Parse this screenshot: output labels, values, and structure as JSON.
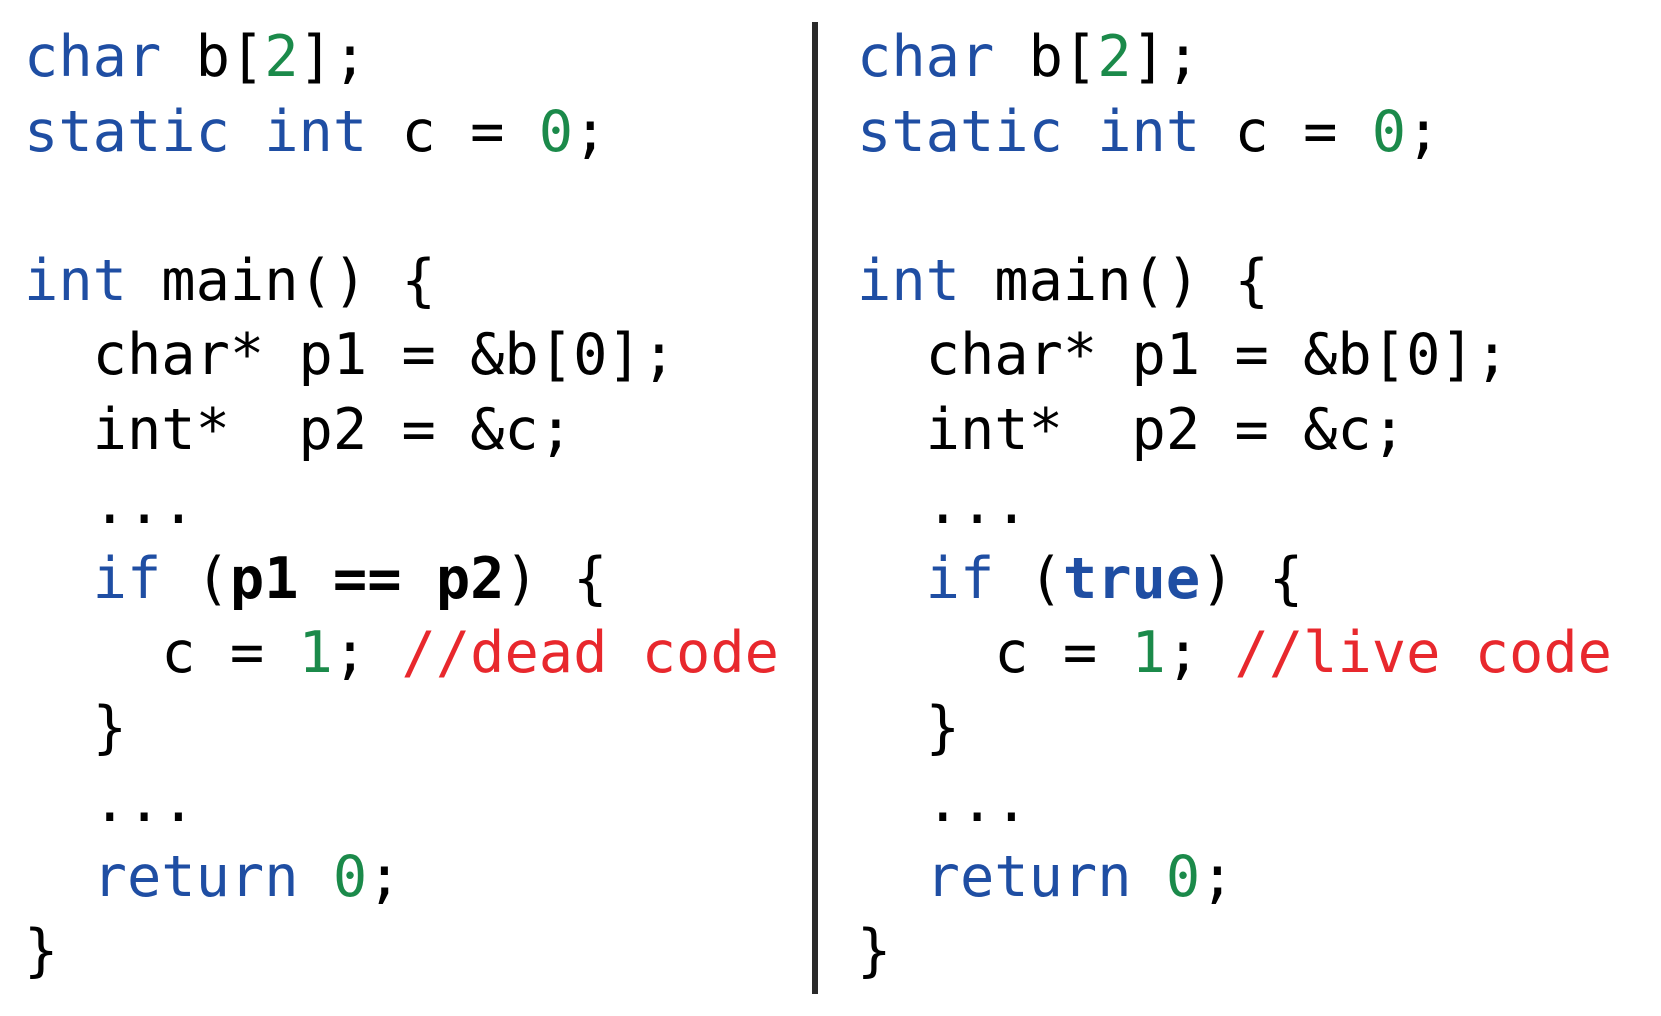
{
  "colors": {
    "keyword": "#1f4ea3",
    "number": "#1b8a4a",
    "comment": "#e8282d",
    "text": "#000000",
    "divider": "#2a2a2a"
  },
  "panels": [
    {
      "name": "left",
      "lines": [
        [
          {
            "t": "char",
            "c": "kw"
          },
          {
            "t": " b[",
            "c": "txt"
          },
          {
            "t": "2",
            "c": "num"
          },
          {
            "t": "];",
            "c": "txt"
          }
        ],
        [
          {
            "t": "static",
            "c": "kw"
          },
          {
            "t": " ",
            "c": "txt"
          },
          {
            "t": "int",
            "c": "kw"
          },
          {
            "t": " c = ",
            "c": "txt"
          },
          {
            "t": "0",
            "c": "num"
          },
          {
            "t": ";",
            "c": "txt"
          }
        ],
        [],
        [
          {
            "t": "int",
            "c": "kw"
          },
          {
            "t": " main() {",
            "c": "txt"
          }
        ],
        [
          {
            "t": "  char* p1 = &b[0];",
            "c": "txt"
          }
        ],
        [
          {
            "t": "  int*  p2 = &c;",
            "c": "txt"
          }
        ],
        [
          {
            "t": "  ...",
            "c": "txt"
          }
        ],
        [
          {
            "t": "  ",
            "c": "txt"
          },
          {
            "t": "if",
            "c": "kw"
          },
          {
            "t": " (",
            "c": "txt"
          },
          {
            "t": "p1 == p2",
            "c": "txt",
            "b": true
          },
          {
            "t": ") {",
            "c": "txt"
          }
        ],
        [
          {
            "t": "    c = ",
            "c": "txt"
          },
          {
            "t": "1",
            "c": "num"
          },
          {
            "t": "; ",
            "c": "txt"
          },
          {
            "t": "//dead code",
            "c": "cmt"
          }
        ],
        [
          {
            "t": "  }",
            "c": "txt"
          }
        ],
        [
          {
            "t": "  ...",
            "c": "txt"
          }
        ],
        [
          {
            "t": "  ",
            "c": "txt"
          },
          {
            "t": "return",
            "c": "kw"
          },
          {
            "t": " ",
            "c": "txt"
          },
          {
            "t": "0",
            "c": "num"
          },
          {
            "t": ";",
            "c": "txt"
          }
        ],
        [
          {
            "t": "}",
            "c": "txt"
          }
        ]
      ]
    },
    {
      "name": "right",
      "lines": [
        [
          {
            "t": "char",
            "c": "kw"
          },
          {
            "t": " b[",
            "c": "txt"
          },
          {
            "t": "2",
            "c": "num"
          },
          {
            "t": "];",
            "c": "txt"
          }
        ],
        [
          {
            "t": "static",
            "c": "kw"
          },
          {
            "t": " ",
            "c": "txt"
          },
          {
            "t": "int",
            "c": "kw"
          },
          {
            "t": " c = ",
            "c": "txt"
          },
          {
            "t": "0",
            "c": "num"
          },
          {
            "t": ";",
            "c": "txt"
          }
        ],
        [],
        [
          {
            "t": "int",
            "c": "kw"
          },
          {
            "t": " main() {",
            "c": "txt"
          }
        ],
        [
          {
            "t": "  char* p1 = &b[0];",
            "c": "txt"
          }
        ],
        [
          {
            "t": "  int*  p2 = &c;",
            "c": "txt"
          }
        ],
        [
          {
            "t": "  ...",
            "c": "txt"
          }
        ],
        [
          {
            "t": "  ",
            "c": "txt"
          },
          {
            "t": "if",
            "c": "kw"
          },
          {
            "t": " (",
            "c": "txt"
          },
          {
            "t": "true",
            "c": "kw",
            "b": true
          },
          {
            "t": ") {",
            "c": "txt"
          }
        ],
        [
          {
            "t": "    c = ",
            "c": "txt"
          },
          {
            "t": "1",
            "c": "num"
          },
          {
            "t": "; ",
            "c": "txt"
          },
          {
            "t": "//live code",
            "c": "cmt"
          }
        ],
        [
          {
            "t": "  }",
            "c": "txt"
          }
        ],
        [
          {
            "t": "  ...",
            "c": "txt"
          }
        ],
        [
          {
            "t": "  ",
            "c": "txt"
          },
          {
            "t": "return",
            "c": "kw"
          },
          {
            "t": " ",
            "c": "txt"
          },
          {
            "t": "0",
            "c": "num"
          },
          {
            "t": ";",
            "c": "txt"
          }
        ],
        [
          {
            "t": "}",
            "c": "txt"
          }
        ]
      ]
    }
  ]
}
